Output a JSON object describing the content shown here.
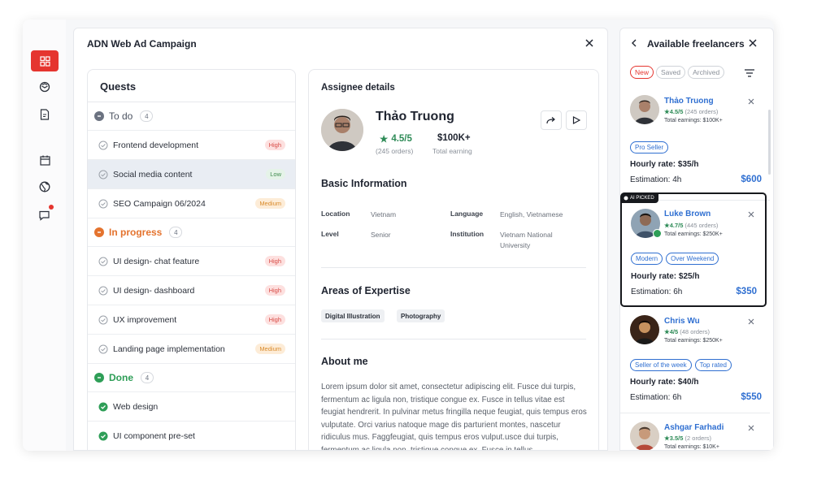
{
  "rail": {
    "items": [
      "grid-icon",
      "layers-icon",
      "file-icon",
      "calendar-icon",
      "globe-icon",
      "chat-icon"
    ],
    "accent": "#e5352f"
  },
  "main": {
    "title": "ADN Web Ad Campaign"
  },
  "quests": {
    "title": "Quests",
    "groups": [
      {
        "label": "To do",
        "count": "4",
        "color": "#6b7280",
        "tasks": [
          {
            "label": "Frontend development",
            "priority": "High"
          },
          {
            "label": "Social media content",
            "priority": "Low"
          },
          {
            "label": "SEO Campaign 06/2024",
            "priority": "Medium"
          }
        ]
      },
      {
        "label": "In progress",
        "count": "4",
        "color": "#e4732e",
        "tasks": [
          {
            "label": "UI design- chat feature",
            "priority": "High"
          },
          {
            "label": "UI design- dashboard",
            "priority": "High"
          },
          {
            "label": "UX improvement",
            "priority": "High"
          },
          {
            "label": "Landing page implementation",
            "priority": "Medium"
          }
        ]
      },
      {
        "label": "Done",
        "count": "4",
        "color": "#2e9e57",
        "tasks": [
          {
            "label": "Web design",
            "priority": ""
          },
          {
            "label": "UI component pre-set",
            "priority": ""
          }
        ]
      }
    ]
  },
  "assignee": {
    "heading": "Assignee details",
    "name": "Thảo Truong",
    "rating": "4.5/5",
    "orders": "(245 orders)",
    "earning": "$100K+",
    "earning_label": "Total earning",
    "basic_info_title": "Basic Information",
    "location_label": "Location",
    "location": "Vietnam",
    "language_label": "Language",
    "language": "English, Vietnamese",
    "level_label": "Level",
    "level": "Senior",
    "institution_label": "Institution",
    "institution_line1": "Vietnam National",
    "institution_line2": "University",
    "expertise_title": "Areas of Expertise",
    "expertise": [
      "Digital Illustration",
      "Photography"
    ],
    "about_title": "About me",
    "about_text": "Lorem ipsum dolor sit amet, consectetur adipiscing elit. Fusce dui turpis, fermentum ac ligula non, tristique congue ex. Fusce in tellus vitae est feugiat hendrerit. In pulvinar metus fringilla neque feugiat, quis tempus eros vulputate. Orci varius natoque mage dis parturient montes, nascetur ridiculus mus. Faggfeugiat, quis tempus eros vulput.usce dui turpis, fermentum ac ligula non, tristique congue ex. Fusce in tellus"
  },
  "freelancers": {
    "title": "Available freelancers",
    "tabs": [
      "New",
      "Saved",
      "Archived"
    ],
    "ai_tag": "AI PICKED",
    "hourly_prefix": "Hourly rate: ",
    "estimation_prefix": "Estimation: ",
    "items": [
      {
        "name": "Thảo Truong",
        "rating": "4.5/5",
        "orders": "(245 orders)",
        "earnings": "Total earnings: $100K+",
        "badges": [
          "Pro Seller"
        ],
        "hourly": "$35/h",
        "estimation": "4h",
        "price": "$600"
      },
      {
        "name": "Luke Brown",
        "rating": "4.7/5",
        "orders": "(445 orders)",
        "earnings": "Total earnings: $250K+",
        "badges": [
          "Modern",
          "Over Weekend"
        ],
        "hourly": "$25/h",
        "estimation": "6h",
        "price": "$350"
      },
      {
        "name": "Chris Wu",
        "rating": "4/5",
        "orders": "(48 orders)",
        "earnings": "Total earnings: $250K+",
        "badges": [
          "Seller of the week",
          "Top rated"
        ],
        "hourly": "$40/h",
        "estimation": "6h",
        "price": "$550"
      },
      {
        "name": "Ashgar Farhadi",
        "rating": "3.5/5",
        "orders": "(2 orders)",
        "earnings": "Total earnings: $10K+",
        "badges": [],
        "hourly": "",
        "estimation": "",
        "price": ""
      }
    ]
  }
}
